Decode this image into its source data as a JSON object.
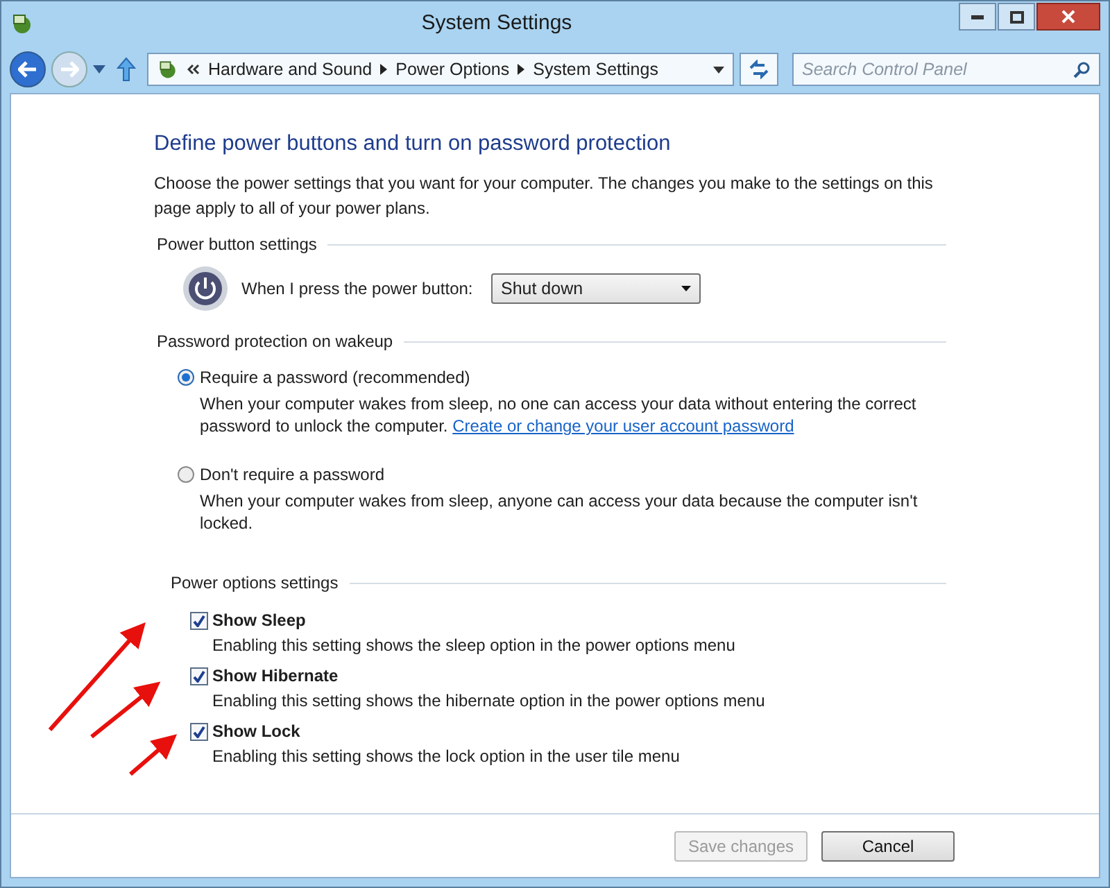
{
  "window": {
    "title": "System Settings"
  },
  "address_bar": {
    "breadcrumb": [
      "Hardware and Sound",
      "Power Options",
      "System Settings"
    ]
  },
  "search": {
    "placeholder": "Search Control Panel"
  },
  "heading": "Define power buttons and turn on password protection",
  "intro": "Choose the power settings that you want for your computer. The changes you make to the settings on this page apply to all of your power plans.",
  "power_button": {
    "title": "Power button settings",
    "label": "When I press the power button:",
    "value": "Shut down"
  },
  "password": {
    "title": "Password protection on wakeup",
    "options": [
      {
        "label": "Require a password (recommended)",
        "description": "When your computer wakes from sleep, no one can access your data without entering the correct password to unlock the computer.",
        "link": "Create or change your user account password",
        "selected": true
      },
      {
        "label": "Don't require a password",
        "description": "When your computer wakes from sleep, anyone can access your data because the computer isn't locked.",
        "selected": false
      }
    ]
  },
  "power_options": {
    "title": "Power options settings",
    "items": [
      {
        "label": "Show Sleep",
        "description": "Enabling this setting shows the sleep option in the power options menu",
        "checked": true
      },
      {
        "label": "Show Hibernate",
        "description": "Enabling this setting shows the hibernate option in the power options menu",
        "checked": true
      },
      {
        "label": "Show Lock",
        "description": "Enabling this setting shows the lock option in the user tile menu",
        "checked": true
      }
    ]
  },
  "buttons": [
    {
      "label": "Save changes",
      "disabled": true
    },
    {
      "label": "Cancel",
      "disabled": false
    }
  ]
}
